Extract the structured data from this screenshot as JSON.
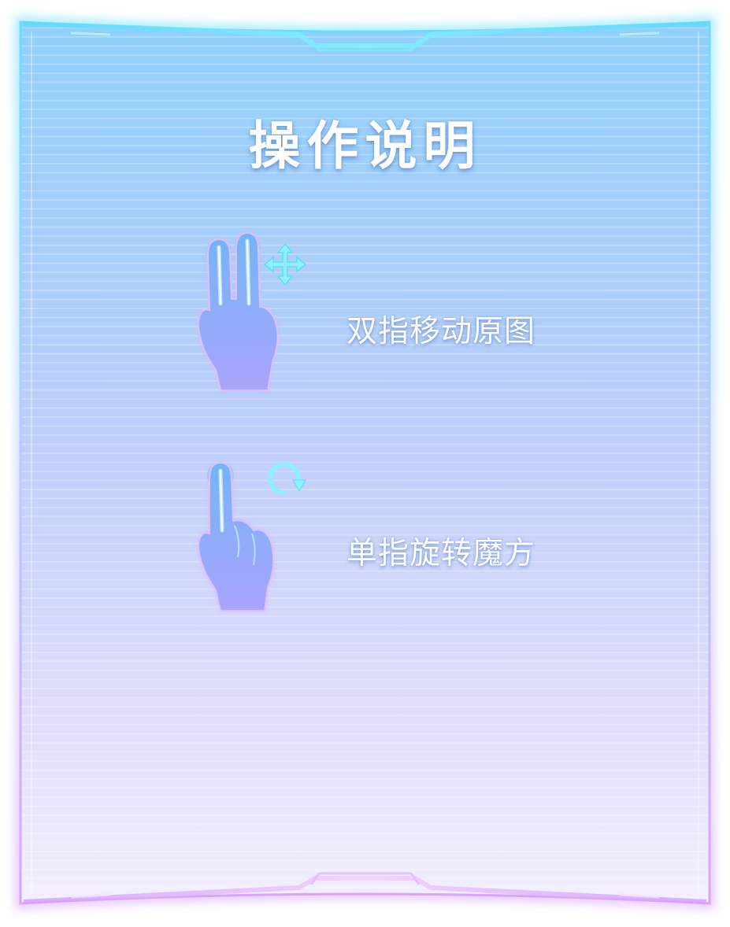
{
  "panel": {
    "title": "操作说明"
  },
  "instructions": [
    {
      "icon": "two-finger-move-icon",
      "text": "双指移动原图"
    },
    {
      "icon": "one-finger-rotate-icon",
      "text": "单指旋转魔方"
    }
  ],
  "colors": {
    "top": "#8fd0fb",
    "bottom": "#f2eefd",
    "frame_top": "#6fe0ff",
    "frame_bottom": "#d8a6ff",
    "hand_fill_top": "#78b0f6",
    "hand_fill_bottom": "#a9a8fb",
    "accent": "#6ce6ff"
  }
}
